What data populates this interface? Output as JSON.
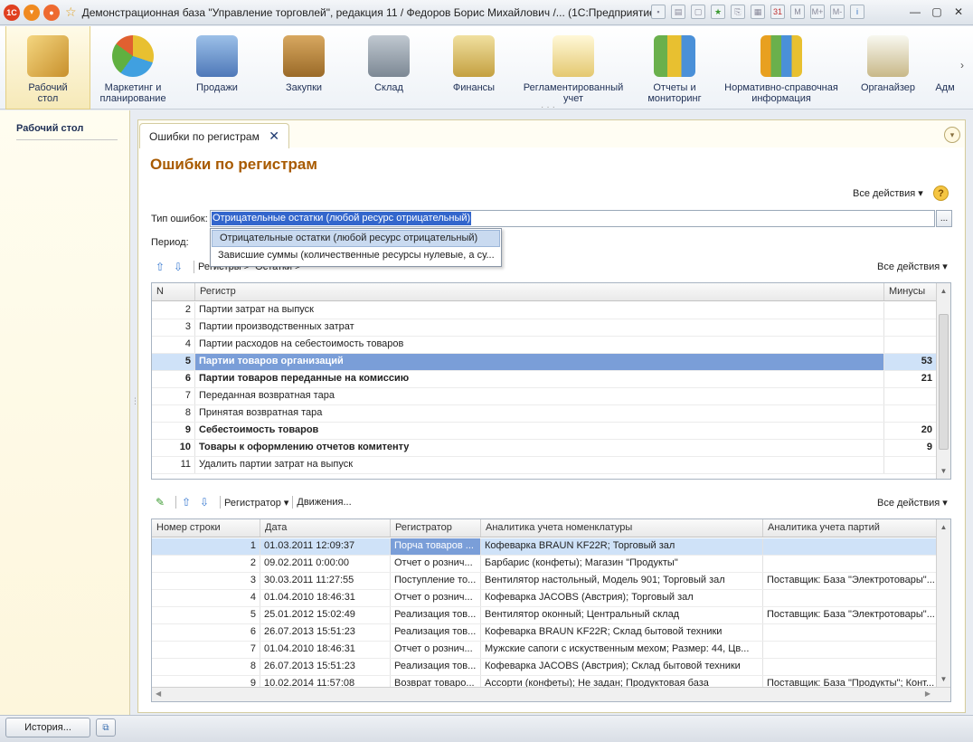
{
  "window": {
    "title": "Демонстрационная база \"Управление торговлей\", редакция 11 / Федоров Борис Михайлович /...   (1С:Предприятие)"
  },
  "sections": [
    {
      "label": "Рабочий стол",
      "icon": "desktop-icon"
    },
    {
      "label": "Маркетинг и планирование",
      "icon": "pie-chart-icon"
    },
    {
      "label": "Продажи",
      "icon": "truck-icon"
    },
    {
      "label": "Закупки",
      "icon": "boxes-icon"
    },
    {
      "label": "Склад",
      "icon": "warehouse-shelves-icon"
    },
    {
      "label": "Финансы",
      "icon": "coins-icon"
    },
    {
      "label": "Регламентированный учет",
      "icon": "document-stamp-icon"
    },
    {
      "label": "Отчеты и мониторинг",
      "icon": "bar-chart-icon"
    },
    {
      "label": "Нормативно-справочная информация",
      "icon": "binders-icon"
    },
    {
      "label": "Органайзер",
      "icon": "clipboard-icon"
    },
    {
      "label": "Адм",
      "icon": "admin-icon"
    }
  ],
  "left_panel": {
    "item": "Рабочий стол"
  },
  "tab": {
    "label": "Ошибки по регистрам"
  },
  "form": {
    "title": "Ошибки по регистрам",
    "all_actions": "Все действия",
    "error_type_label": "Тип ошибок:",
    "error_type_value": "Отрицательные остатки (любой ресурс отрицательный)",
    "period_label": "Период:",
    "dropdown_options": [
      "Отрицательные остатки (любой ресурс отрицательный)",
      "Зависшие суммы (количественные ресурсы нулевые, а су..."
    ]
  },
  "registers_toolbar": {
    "tab1": "Регистры >",
    "tab2": "Остатки >",
    "all_actions": "Все действия"
  },
  "registers_table": {
    "columns": [
      "N",
      "Регистр",
      "Минусы"
    ],
    "rows": [
      {
        "n": "2",
        "name": "Партии затрат на выпуск",
        "minus": "",
        "bold": false
      },
      {
        "n": "3",
        "name": "Партии производственных затрат",
        "minus": "",
        "bold": false
      },
      {
        "n": "4",
        "name": "Партии расходов на себестоимость товаров",
        "minus": "",
        "bold": false
      },
      {
        "n": "5",
        "name": "Партии товаров организаций",
        "minus": "53",
        "bold": true
      },
      {
        "n": "6",
        "name": "Партии товаров переданные на комиссию",
        "minus": "21",
        "bold": true
      },
      {
        "n": "7",
        "name": "Переданная возвратная тара",
        "minus": "",
        "bold": false
      },
      {
        "n": "8",
        "name": "Принятая возвратная тара",
        "minus": "",
        "bold": false
      },
      {
        "n": "9",
        "name": "Себестоимость товаров",
        "minus": "20",
        "bold": true
      },
      {
        "n": "10",
        "name": "Товары к оформлению отчетов комитенту",
        "minus": "9",
        "bold": true
      },
      {
        "n": "11",
        "name": "Удалить партии затрат на выпуск",
        "minus": "",
        "bold": false
      }
    ]
  },
  "movements_toolbar": {
    "registrar": "Регистратор",
    "movements": "Движения...",
    "all_actions": "Все действия"
  },
  "movements_table": {
    "columns": [
      "Номер строки",
      "Дата",
      "Регистратор",
      "Аналитика учета номенклатуры",
      "Аналитика учета партий"
    ],
    "rows": [
      {
        "n": "1",
        "date": "01.03.2011 12:09:37",
        "reg": "Порча товаров ...",
        "nom": "Кофеварка BRAUN KF22R; Торговый зал",
        "part": ""
      },
      {
        "n": "2",
        "date": "09.02.2011 0:00:00",
        "reg": "Отчет о рознич...",
        "nom": "Барбарис (конфеты); Магазин \"Продукты\"",
        "part": ""
      },
      {
        "n": "3",
        "date": "30.03.2011 11:27:55",
        "reg": "Поступление то...",
        "nom": "Вентилятор настольный, Модель 901; Торговый зал",
        "part": "Поставщик: База \"Электротовары\"..."
      },
      {
        "n": "4",
        "date": "01.04.2010 18:46:31",
        "reg": "Отчет о рознич...",
        "nom": "Кофеварка JACOBS (Австрия); Торговый зал",
        "part": ""
      },
      {
        "n": "5",
        "date": "25.01.2012 15:02:49",
        "reg": "Реализация тов...",
        "nom": "Вентилятор оконный; Центральный склад",
        "part": "Поставщик: База \"Электротовары\"..."
      },
      {
        "n": "6",
        "date": "26.07.2013 15:51:23",
        "reg": "Реализация тов...",
        "nom": "Кофеварка BRAUN KF22R; Склад бытовой техники",
        "part": ""
      },
      {
        "n": "7",
        "date": "01.04.2010 18:46:31",
        "reg": "Отчет о рознич...",
        "nom": "Мужские сапоги с искуственным мехом; Размер: 44, Цв...",
        "part": ""
      },
      {
        "n": "8",
        "date": "26.07.2013 15:51:23",
        "reg": "Реализация тов...",
        "nom": "Кофеварка JACOBS (Австрия); Склад бытовой техники",
        "part": ""
      },
      {
        "n": "9",
        "date": "10.02.2014 11:57:08",
        "reg": "Возврат товаро...",
        "nom": "Ассорти (конфеты); Не задан; Продуктовая база",
        "part": "Поставщик: База \"Продукты\"; Конт..."
      }
    ]
  },
  "bottom": {
    "history_button": "История..."
  }
}
